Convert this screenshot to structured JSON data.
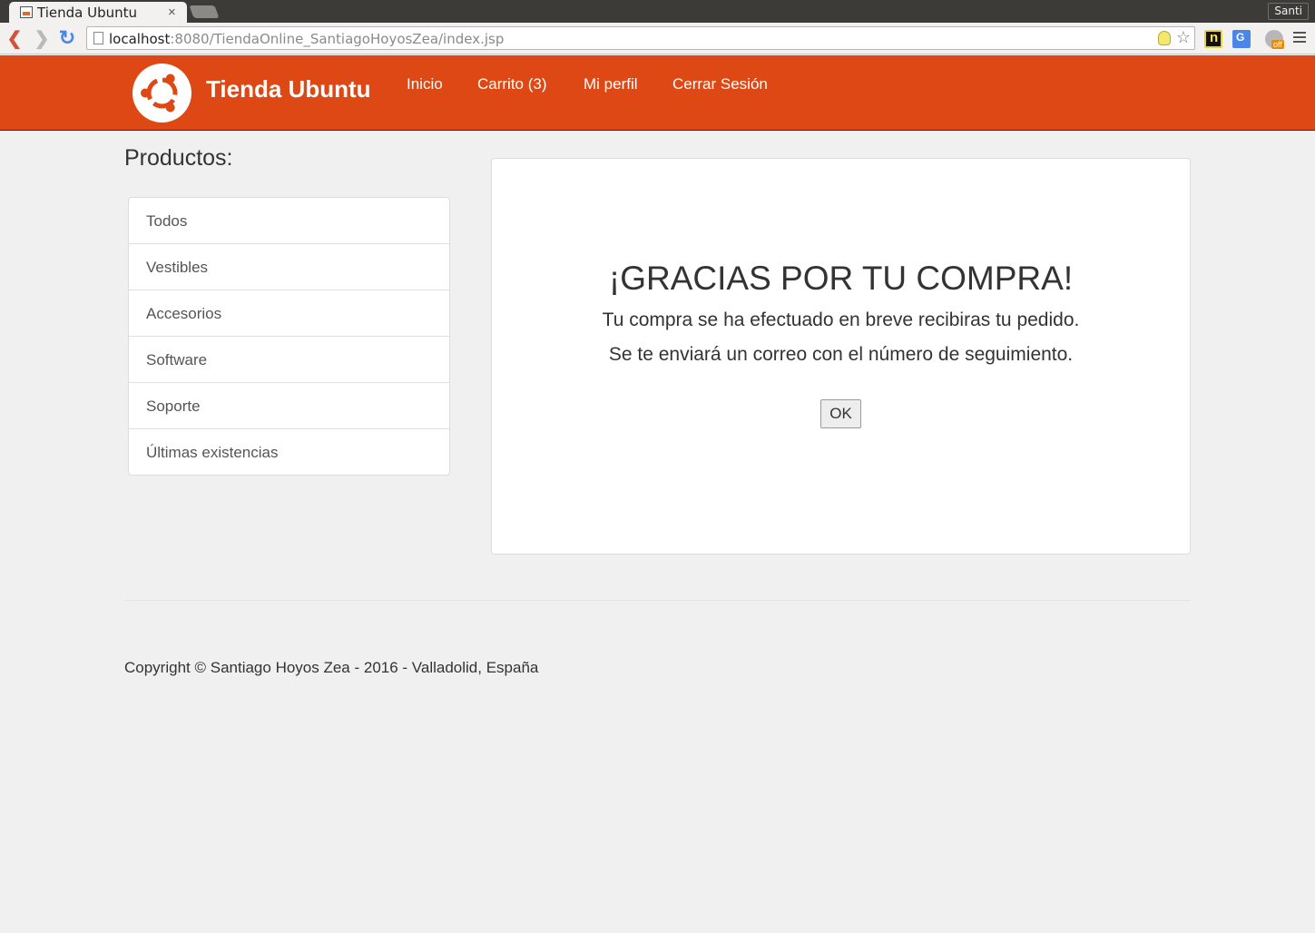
{
  "browser": {
    "tab_title": "Tienda Ubuntu",
    "tab_close": "×",
    "profile_name": "Santi",
    "url_host": "localhost",
    "url_path": ":8080/TiendaOnline_SantiagoHoyosZea/index.jsp"
  },
  "navbar": {
    "brand": "Tienda Ubuntu",
    "links": [
      "Inicio",
      "Carrito (3)",
      "Mi perfil",
      "Cerrar Sesión"
    ],
    "color": "#dd4814"
  },
  "sidebar": {
    "title": "Productos:",
    "items": [
      "Todos",
      "Vestibles",
      "Accesorios",
      "Software",
      "Soporte",
      "Últimas existencias"
    ]
  },
  "confirmation": {
    "heading": "¡GRACIAS POR TU COMPRA!",
    "line1": "Tu compra se ha efectuado en breve recibiras tu pedido.",
    "line2": "Se te enviará un correo con el número de seguimiento.",
    "ok_label": "OK"
  },
  "footer": {
    "copyright": "Copyright © Santiago Hoyos Zea - 2016 - Valladolid, España"
  }
}
